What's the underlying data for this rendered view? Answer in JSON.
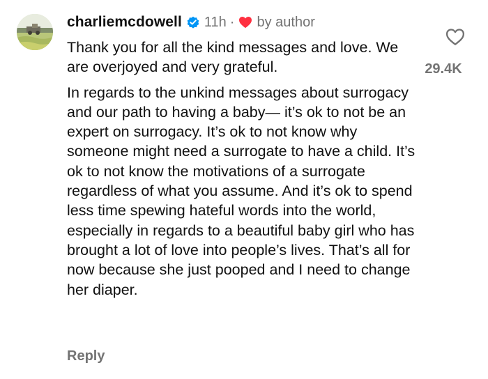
{
  "comment": {
    "username": "charliemcdowell",
    "verified": true,
    "time": "11h",
    "separator": "·",
    "author_like_label": "by author",
    "text_paragraphs": [
      "Thank you for all the kind messages and love. We are overjoyed and very grateful.",
      "In regards to the unkind messages about surrogacy and our path to having a baby— it’s ok to not be an expert on surrogacy. It’s ok to not know why someone might need a surrogate to have a child. It’s ok to not know the motivations of a surrogate regardless of what you assume. And it’s ok to spend less time spewing hateful words into the world, especially in regards to a beautiful baby girl who has brought a lot of love into people’s lives. That’s all for now because she just pooped and I need to change her diaper."
    ],
    "reply_label": "Reply",
    "like_count": "29.4K"
  },
  "icons": {
    "avatar": "avatar-photo",
    "verified": "verified-badge-icon",
    "author_heart": "heart-filled-icon",
    "like": "heart-outline-icon"
  },
  "colors": {
    "text": "#111111",
    "secondary": "#737373",
    "verified_blue": "#0095f6",
    "heart_red": "#ff3040"
  }
}
